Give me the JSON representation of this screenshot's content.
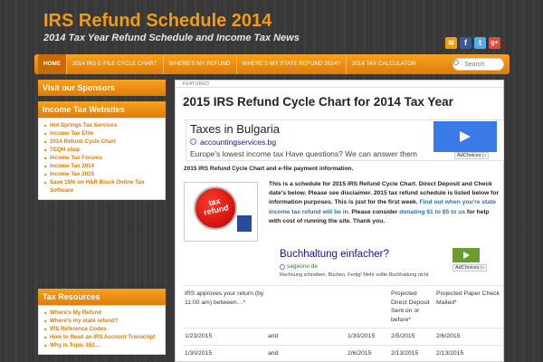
{
  "site": {
    "title": "IRS Refund Schedule 2014",
    "subtitle": "2014 Tax Year Refund Schedule and Income Tax News"
  },
  "social": [
    {
      "icon": "rss-icon",
      "glyph": "≋",
      "color": "#f39c12"
    },
    {
      "icon": "facebook-icon",
      "glyph": "f",
      "color": "#3b5998"
    },
    {
      "icon": "twitter-icon",
      "glyph": "t",
      "color": "#55acee"
    },
    {
      "icon": "google-plus-icon",
      "glyph": "g+",
      "color": "#dd4b39"
    }
  ],
  "nav": {
    "items": [
      "HOME",
      "2014 IRS E-FILE CYCLE CHART",
      "WHERE'S MY REFUND",
      "WHERE'S MY STATE REFUND 2014?",
      "2014 TAX CALCULATOR"
    ],
    "search_placeholder": "Search"
  },
  "sidebar": {
    "sponsors_title": "Visit our Sponsors",
    "websites_title": "Income Tax Websites",
    "websites": [
      "Hot Springs Tax Services",
      "Income Tax Efile",
      "2014 Refund Cycle Chart",
      "TEQH shop",
      "Income Tax Forums",
      "Income Tax 2014",
      "Income Tax 2015",
      "Save 15% on H&R Block Online Tax Software"
    ],
    "resources_title": "Tax Resources",
    "resources": [
      "Where's My Refund",
      "Where's my state refund?",
      "IRS Reference Codes",
      "How to Read an IRS Account Transcript",
      "Why is Topic 152..."
    ]
  },
  "post": {
    "featured_label": "FEATURED",
    "title": "2015 IRS Refund Cycle Chart for 2014 Tax Year",
    "subhead": "2015 IRS Refund Cycle Chart and e-file payment information.",
    "image_text_line1": "tax",
    "image_text_line2": "refund",
    "intro_part1": "This is a schedule for 2015 IRS Refund Cycle Chart. Direct Deposit and Check date's below. Please see disclaimer. 2015 tax refund schedule is listed below for information purposes. This is just for the first week. ",
    "link1": "Find out when you're state income tax refund will be in.",
    "intro_part2": " Please consider ",
    "link2": "donating $1 to $5 to us",
    "intro_part3": " for help with cost of running the site. Thank you."
  },
  "ad1": {
    "title": "Taxes in Bulgaria",
    "url": "accountingservices.bg",
    "desc": "Europe's lowest income tax Have questions? We can answer them",
    "adchoices": "AdChoices ▷"
  },
  "ad2": {
    "title": "Buchhaltung einfacher?",
    "url": "sageone.de",
    "desc": "Rechnung schreiben, Buchen, Fertig! Mehr sollte Buchhaltung nicht",
    "adchoices": "AdChoices ▷"
  },
  "table": {
    "header": [
      "IRS approves your return (by 11:00 am) between…*",
      "",
      "",
      "Projected Direct Deposit Sent on or before*",
      "Projected Paper Check Mailed*"
    ],
    "rows": [
      [
        "1/23/2015",
        "and",
        "1/30/2015",
        "2/5/2015",
        "2/6/2015"
      ],
      [
        "1/30/2015",
        "and",
        "2/6/2015",
        "2/13/2015",
        "2/13/2015"
      ]
    ]
  }
}
